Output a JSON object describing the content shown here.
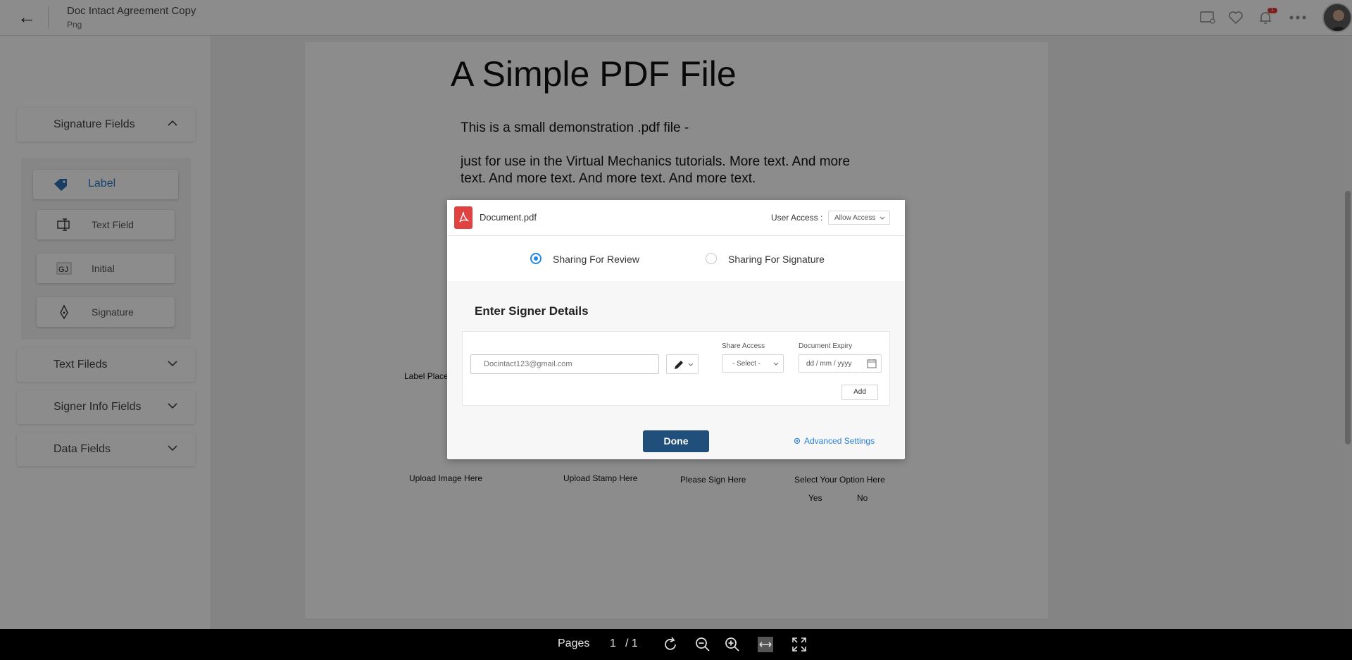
{
  "header": {
    "back_label": "←",
    "title": "Doc Intact Agreement Copy",
    "subtitle": "Png",
    "notification_count": "1"
  },
  "sidebar": {
    "sections": [
      {
        "label": "Signature Fields",
        "expanded": true
      },
      {
        "label": "Text Fileds",
        "expanded": false
      },
      {
        "label": "Signer Info Fields",
        "expanded": false
      },
      {
        "label": "Data Fields",
        "expanded": false
      }
    ],
    "signature_items": [
      {
        "label": "Label",
        "icon": "tag-icon",
        "active": true
      },
      {
        "label": "Text Field",
        "icon": "text-cursor-icon",
        "active": false
      },
      {
        "label": "Initial",
        "icon": "initials-icon",
        "active": false
      },
      {
        "label": "Signature",
        "icon": "pen-nib-icon",
        "active": false
      }
    ]
  },
  "document": {
    "heading": "A Simple PDF File",
    "para1": "This is a small demonstration .pdf file -",
    "para2_line1": "just for use in the Virtual Mechanics tutorials. More text. And more",
    "para2_line2": "text. And more text. And more text. And more text.",
    "label_place": "Label Place H",
    "upload_image": "Upload Image Here",
    "upload_stamp": "Upload Stamp Here",
    "please_sign": "Please Sign Here",
    "select_option": "Select Your Option Here",
    "opt_yes": "Yes",
    "opt_no": "No"
  },
  "modal": {
    "file_name": "Document.pdf",
    "user_access_label": "User Access :",
    "user_access_value": "Allow Access",
    "radio_review": "Sharing For Review",
    "radio_signature": "Sharing For Signature",
    "selected": "review",
    "section_title": "Enter Signer Details",
    "email_placeholder": "Docintact123@gmail.com",
    "share_access_label": "Share Access",
    "share_access_value": "- Select -",
    "expiry_label": "Document Expiry",
    "expiry_placeholder": "dd / mm / yyyy",
    "add_label": "Add",
    "done_label": "Done",
    "advanced_label": "Advanced Settings"
  },
  "bottom_bar": {
    "pages_label": "Pages",
    "current_page": "1",
    "total_pages": "/ 1"
  },
  "colors": {
    "accent": "#1e88e5",
    "done_button": "#1f4f7a",
    "pdf_red": "#e04141",
    "badge_red": "#e53935"
  }
}
